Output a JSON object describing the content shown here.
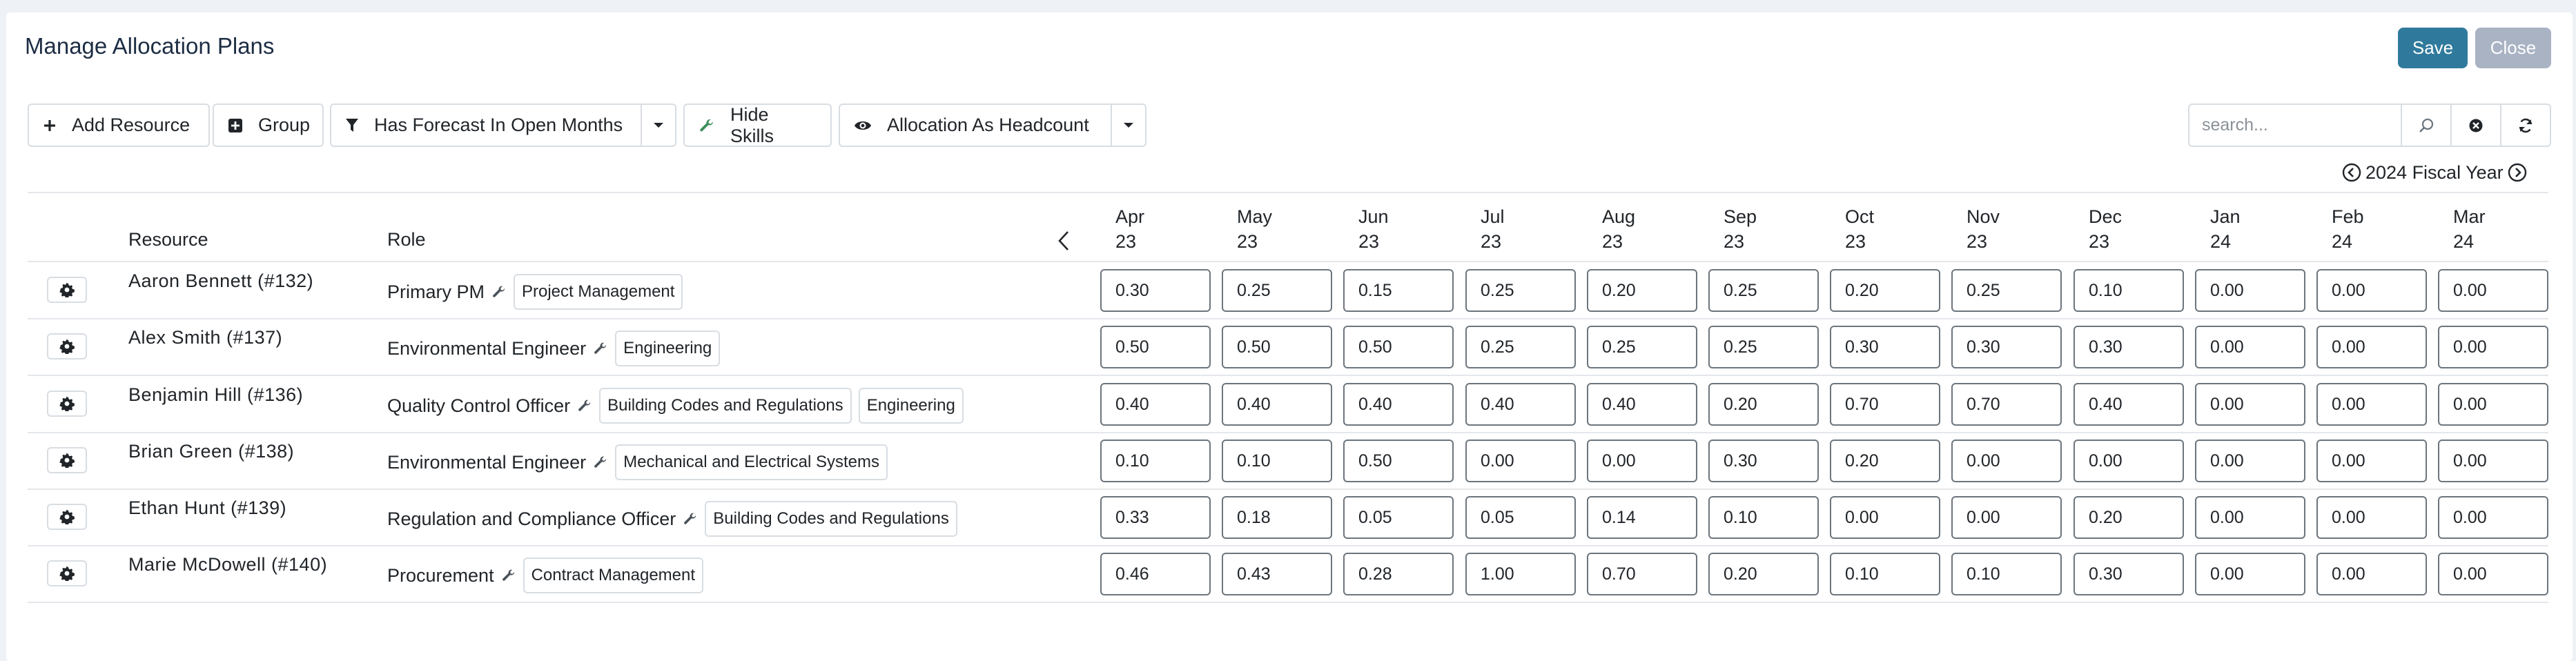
{
  "title": "Manage Allocation Plans",
  "actions": {
    "save": "Save",
    "close": "Close"
  },
  "toolbar": {
    "add_resource": "Add Resource",
    "group": "Group",
    "filter": "Has Forecast In Open Months",
    "hide_skills": "Hide Skills",
    "view_mode": "Allocation As Headcount"
  },
  "search": {
    "placeholder": "search..."
  },
  "fiscal_year": "2024 Fiscal Year",
  "columns": {
    "resource": "Resource",
    "role": "Role"
  },
  "months": [
    {
      "m": "Apr",
      "y": "23"
    },
    {
      "m": "May",
      "y": "23"
    },
    {
      "m": "Jun",
      "y": "23"
    },
    {
      "m": "Jul",
      "y": "23"
    },
    {
      "m": "Aug",
      "y": "23"
    },
    {
      "m": "Sep",
      "y": "23"
    },
    {
      "m": "Oct",
      "y": "23"
    },
    {
      "m": "Nov",
      "y": "23"
    },
    {
      "m": "Dec",
      "y": "23"
    },
    {
      "m": "Jan",
      "y": "24"
    },
    {
      "m": "Feb",
      "y": "24"
    },
    {
      "m": "Mar",
      "y": "24"
    }
  ],
  "rows": [
    {
      "name": "Aaron Bennett (#132)",
      "role": "Primary PM",
      "skills": [
        "Project Management"
      ],
      "values": [
        "0.30",
        "0.25",
        "0.15",
        "0.25",
        "0.20",
        "0.25",
        "0.20",
        "0.25",
        "0.10",
        "0.00",
        "0.00",
        "0.00"
      ]
    },
    {
      "name": "Alex Smith (#137)",
      "role": "Environmental Engineer",
      "skills": [
        "Engineering"
      ],
      "values": [
        "0.50",
        "0.50",
        "0.50",
        "0.25",
        "0.25",
        "0.25",
        "0.30",
        "0.30",
        "0.30",
        "0.00",
        "0.00",
        "0.00"
      ]
    },
    {
      "name": "Benjamin Hill (#136)",
      "role": "Quality Control Officer",
      "skills": [
        "Building Codes and Regulations",
        "Engineering"
      ],
      "values": [
        "0.40",
        "0.40",
        "0.40",
        "0.40",
        "0.40",
        "0.20",
        "0.70",
        "0.70",
        "0.40",
        "0.00",
        "0.00",
        "0.00"
      ]
    },
    {
      "name": "Brian Green (#138)",
      "role": "Environmental Engineer",
      "skills": [
        "Mechanical and Electrical Systems"
      ],
      "values": [
        "0.10",
        "0.10",
        "0.50",
        "0.00",
        "0.00",
        "0.30",
        "0.20",
        "0.00",
        "0.00",
        "0.00",
        "0.00",
        "0.00"
      ]
    },
    {
      "name": "Ethan Hunt (#139)",
      "role": "Regulation and Compliance Officer",
      "skills": [
        "Building Codes and Regulations"
      ],
      "values": [
        "0.33",
        "0.18",
        "0.05",
        "0.05",
        "0.14",
        "0.10",
        "0.00",
        "0.00",
        "0.20",
        "0.00",
        "0.00",
        "0.00"
      ]
    },
    {
      "name": "Marie McDowell (#140)",
      "role": "Procurement",
      "skills": [
        "Contract Management"
      ],
      "values": [
        "0.46",
        "0.43",
        "0.28",
        "1.00",
        "0.70",
        "0.20",
        "0.10",
        "0.10",
        "0.30",
        "0.00",
        "0.00",
        "0.00"
      ]
    }
  ]
}
